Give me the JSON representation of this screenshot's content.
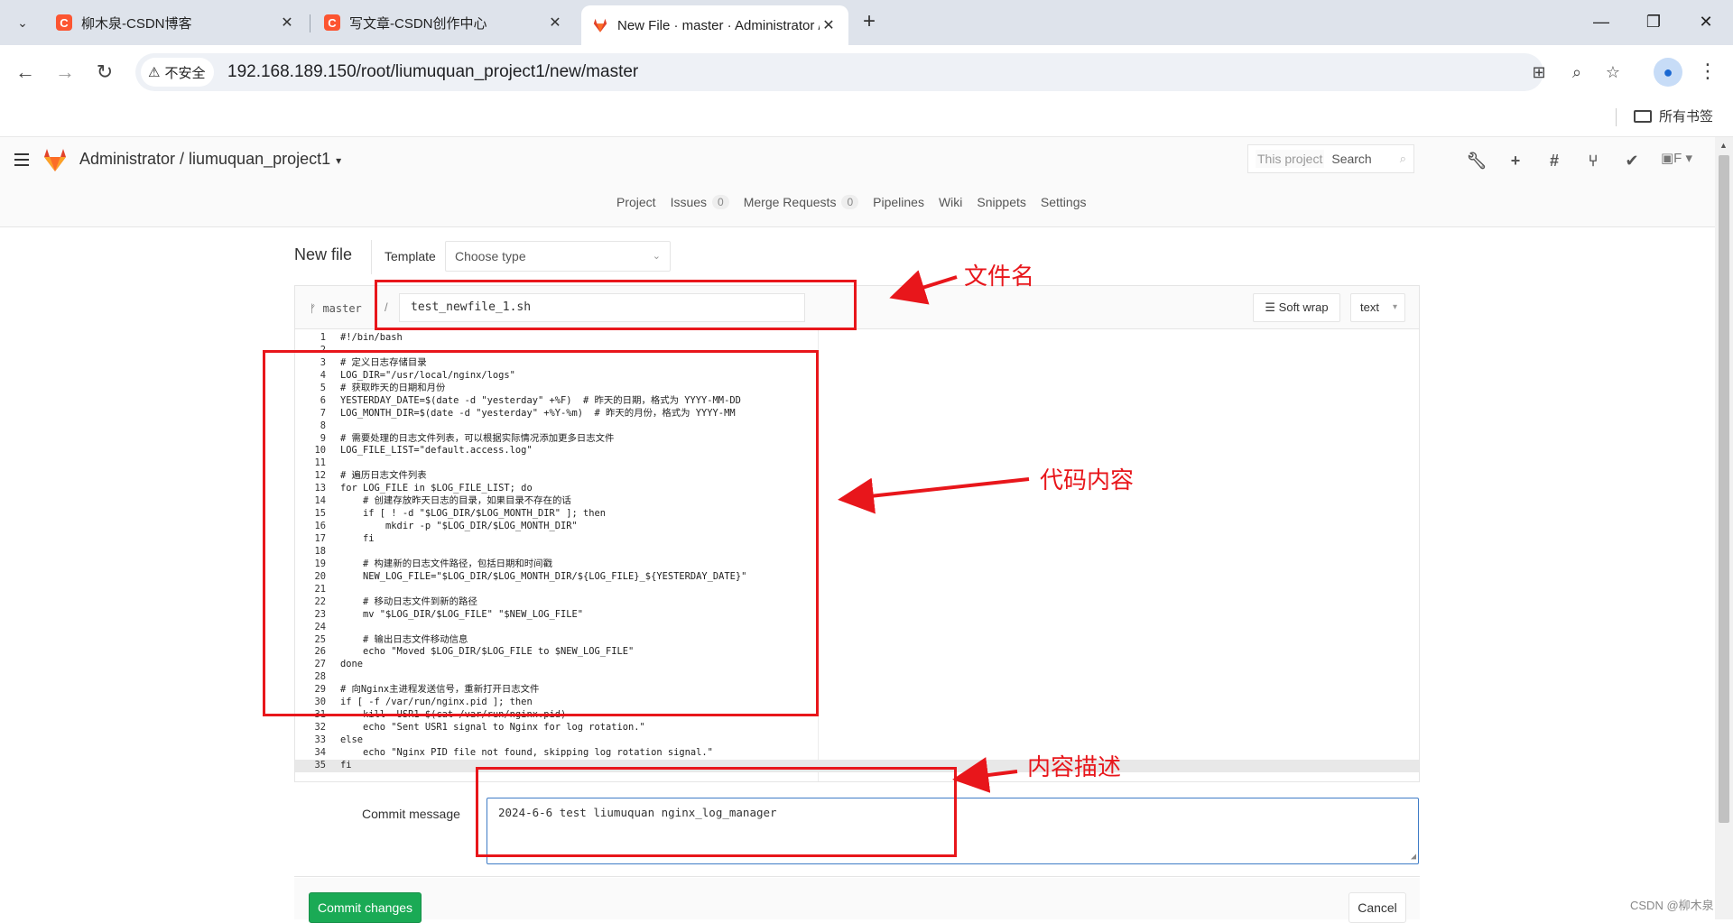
{
  "browser": {
    "tabs": [
      {
        "title": "柳木泉-CSDN博客",
        "favicon": "csdn-icon"
      },
      {
        "title": "写文章-CSDN创作中心",
        "favicon": "csdn-icon"
      },
      {
        "title": "New File · master · Administrator / liumuquan_project1 · GitLab",
        "favicon": "gitlab-icon"
      }
    ],
    "security_label": "不安全",
    "url": "192.168.189.150/root/liumuquan_project1/new/master",
    "bookmarks_folder": "所有书签"
  },
  "gitlab": {
    "breadcrumb": "Administrator / liumuquan_project1",
    "search_scope": "This project",
    "search_placeholder": "Search",
    "subnav": [
      {
        "label": "Project"
      },
      {
        "label": "Issues",
        "badge": "0"
      },
      {
        "label": "Merge Requests",
        "badge": "0"
      },
      {
        "label": "Pipelines"
      },
      {
        "label": "Wiki"
      },
      {
        "label": "Snippets"
      },
      {
        "label": "Settings"
      }
    ],
    "page_title": "New file",
    "template_label": "Template",
    "template_value": "Choose type",
    "branch": "master",
    "path_sep": "/",
    "file_name": "test_newfile_1.sh",
    "soft_wrap_label": "Soft wrap",
    "language": "text",
    "code_lines": [
      "#!/bin/bash",
      "",
      "# 定义日志存储目录",
      "LOG_DIR=\"/usr/local/nginx/logs\"",
      "# 获取昨天的日期和月份",
      "YESTERDAY_DATE=$(date -d \"yesterday\" +%F)  # 昨天的日期，格式为 YYYY-MM-DD",
      "LOG_MONTH_DIR=$(date -d \"yesterday\" +%Y-%m)  # 昨天的月份，格式为 YYYY-MM",
      "",
      "# 需要处理的日志文件列表，可以根据实际情况添加更多日志文件",
      "LOG_FILE_LIST=\"default.access.log\"",
      "",
      "# 遍历日志文件列表",
      "for LOG_FILE in $LOG_FILE_LIST; do",
      "    # 创建存放昨天日志的目录，如果目录不存在的话",
      "    if [ ! -d \"$LOG_DIR/$LOG_MONTH_DIR\" ]; then",
      "        mkdir -p \"$LOG_DIR/$LOG_MONTH_DIR\"",
      "    fi",
      "",
      "    # 构建新的日志文件路径，包括日期和时间戳",
      "    NEW_LOG_FILE=\"$LOG_DIR/$LOG_MONTH_DIR/${LOG_FILE}_${YESTERDAY_DATE}\"",
      "",
      "    # 移动日志文件到新的路径",
      "    mv \"$LOG_DIR/$LOG_FILE\" \"$NEW_LOG_FILE\"",
      "",
      "    # 输出日志文件移动信息",
      "    echo \"Moved $LOG_DIR/$LOG_FILE to $NEW_LOG_FILE\"",
      "done",
      "",
      "# 向Nginx主进程发送信号，重新打开日志文件",
      "if [ -f /var/run/nginx.pid ]; then",
      "    kill -USR1 $(cat /var/run/nginx.pid)",
      "    echo \"Sent USR1 signal to Nginx for log rotation.\"",
      "else",
      "    echo \"Nginx PID file not found, skipping log rotation signal.\"",
      "fi"
    ],
    "commit_label": "Commit message",
    "commit_message": "2024-6-6 test liumuquan nginx_log_manager",
    "commit_button": "Commit changes",
    "cancel_button": "Cancel"
  },
  "annotations": {
    "filename": "文件名",
    "code": "代码内容",
    "description": "内容描述",
    "color": "#e8161b"
  },
  "watermark": "CSDN @柳木泉"
}
